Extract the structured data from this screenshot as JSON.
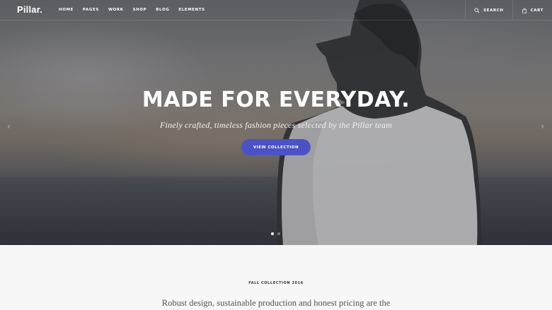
{
  "brand": {
    "logo": "Pillar."
  },
  "nav": {
    "items": [
      {
        "label": "HOME"
      },
      {
        "label": "PAGES"
      },
      {
        "label": "WORK"
      },
      {
        "label": "SHOP"
      },
      {
        "label": "BLOG"
      },
      {
        "label": "ELEMENTS"
      }
    ]
  },
  "actions": {
    "search_label": "SEARCH",
    "cart_label": "CART",
    "search_icon": "search-icon",
    "cart_icon": "bag-icon"
  },
  "hero": {
    "title": "MADE FOR EVERYDAY.",
    "subtitle": "Finely crafted, timeless fashion pieces selected by the Pillar team",
    "cta_label": "VIEW COLLECTION",
    "prev_arrow": "‹",
    "next_arrow": "›",
    "slide_count": 2,
    "active_slide": 1
  },
  "section": {
    "label": "FALL COLLECTION 2016",
    "text": "Robust design, sustainable production and honest pricing are the"
  },
  "colors": {
    "accent": "#4b52c6",
    "section_bg": "#f7f7f7"
  }
}
